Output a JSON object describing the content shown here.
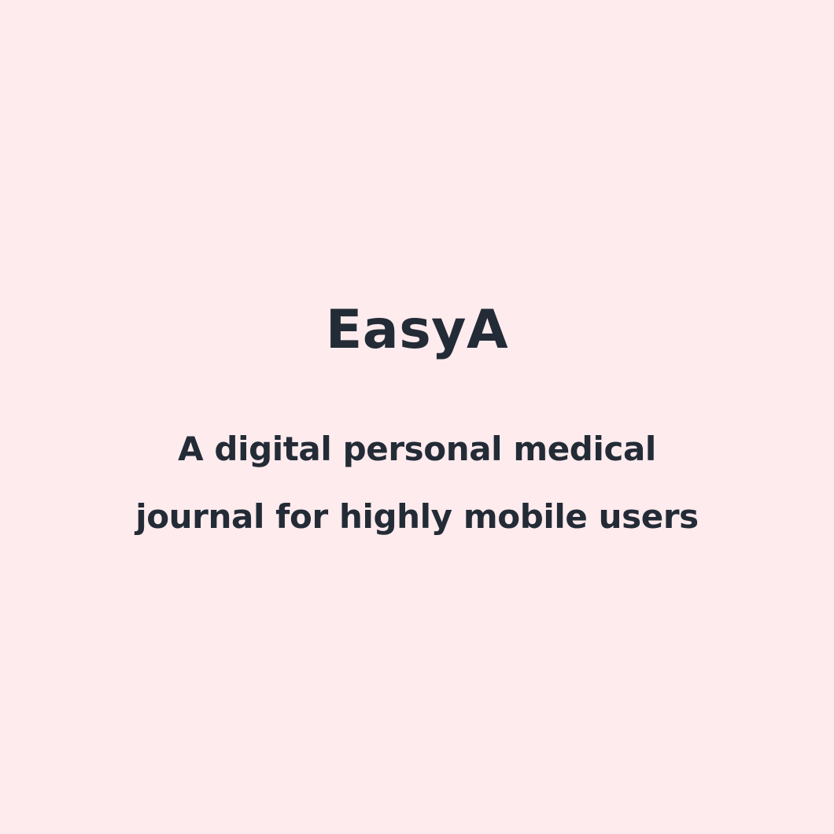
{
  "slide": {
    "title": "EasyA",
    "tagline_lines": [
      "A digital personal medical",
      "journal for highly mobile users"
    ]
  },
  "colors": {
    "background": "#fdebed",
    "text": "#232b36"
  }
}
